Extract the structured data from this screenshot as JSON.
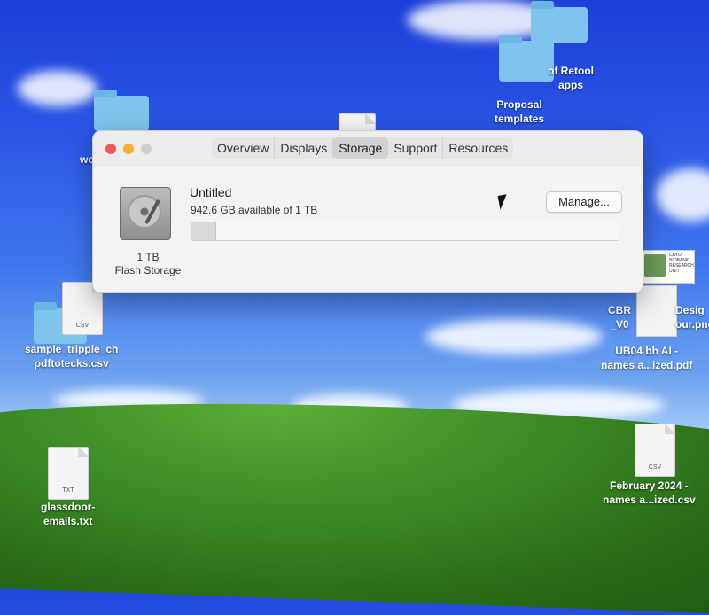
{
  "window": {
    "tabs": [
      {
        "label": "Overview"
      },
      {
        "label": "Displays"
      },
      {
        "label": "Storage"
      },
      {
        "label": "Support"
      },
      {
        "label": "Resources"
      }
    ],
    "active_tab": "Storage"
  },
  "storage": {
    "volume_name": "Untitled",
    "available_text": "942.6 GB available of 1 TB",
    "used_fraction": 0.057,
    "disk_size": "1 TB",
    "disk_type": "Flash Storage",
    "manage_label": "Manage..."
  },
  "desktop": {
    "icons": [
      {
        "label": "of Retool\napps"
      },
      {
        "label": "Proposal\ntemplates"
      },
      {
        "label": "we"
      },
      {
        "label": "sample_tripple_ch\npdftotecks.csv"
      },
      {
        "label": "CBR\n_V0"
      },
      {
        "label": "Desig\nour.png"
      },
      {
        "label": "UB04 bh AI -\nnames a...ized.pdf"
      },
      {
        "label": "glassdoor-\nemails.txt"
      },
      {
        "label": "February 2024 -\nnames a...ized.csv"
      }
    ],
    "doc_exts": {
      "csv": "CSV",
      "txt": "TXT"
    },
    "thumb_text": "CAYO\nBIOBANK\nRESEARCH\nUNIT"
  }
}
